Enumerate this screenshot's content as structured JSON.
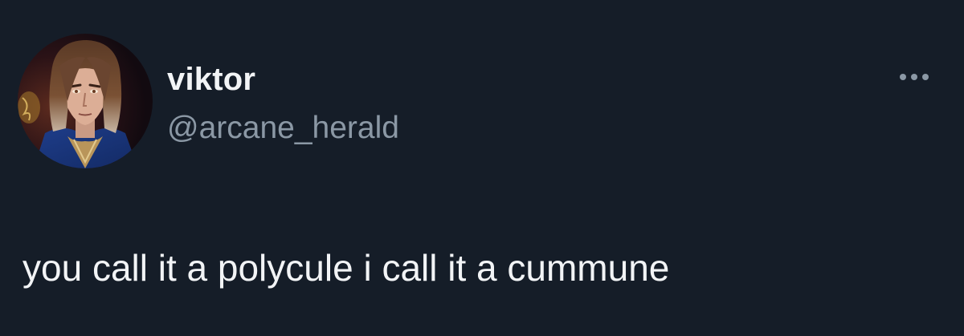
{
  "tweet": {
    "display_name": "viktor",
    "handle": "@arcane_herald",
    "text": "you call it a polycule i call it a cummune",
    "more_icon": "more-horizontal-icon"
  },
  "colors": {
    "background": "#151d28",
    "primary_text": "#f2f4f6",
    "secondary_text": "#8b98a5"
  }
}
